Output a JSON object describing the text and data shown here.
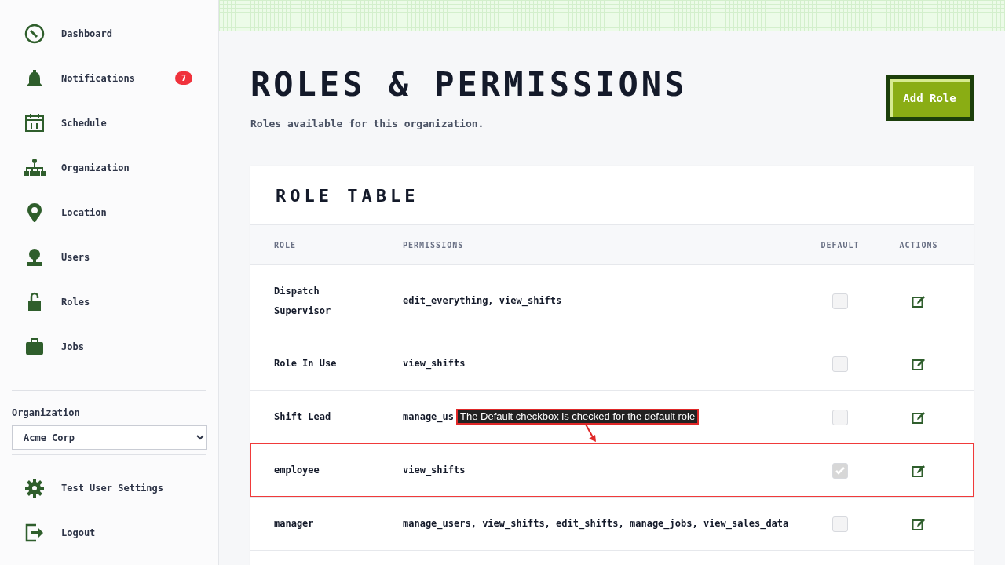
{
  "sidebar": {
    "items": [
      {
        "label": "Dashboard",
        "selected": false
      },
      {
        "label": "Notifications",
        "selected": false,
        "badge": "7"
      },
      {
        "label": "Schedule",
        "selected": false
      },
      {
        "label": "Organization",
        "selected": false
      },
      {
        "label": "Location",
        "selected": false
      },
      {
        "label": "Users",
        "selected": false
      },
      {
        "label": "Roles",
        "selected": false
      },
      {
        "label": "Jobs",
        "selected": false
      }
    ],
    "organization_label": "Organization",
    "organization_value": "Acme Corp",
    "footer_items": [
      {
        "label": "Test User Settings"
      },
      {
        "label": "Logout"
      }
    ]
  },
  "page": {
    "title": "ROLES & PERMISSIONS",
    "subtitle": "Roles available for this organization.",
    "add_button": "Add Role"
  },
  "table": {
    "title": "ROLE TABLE",
    "columns": [
      "ROLE",
      "PERMISSIONS",
      "DEFAULT",
      "ACTIONS"
    ],
    "rows": [
      {
        "role": "Dispatch Supervisor",
        "permissions": "edit_everything, view_shifts",
        "default": false,
        "highlighted": false
      },
      {
        "role": "Role In Use",
        "permissions": "view_shifts",
        "default": false,
        "highlighted": false
      },
      {
        "role": "Shift Lead",
        "permissions": "manage_us",
        "default": false,
        "highlighted": false
      },
      {
        "role": "employee",
        "permissions": "view_shifts",
        "default": true,
        "highlighted": true
      },
      {
        "role": "manager",
        "permissions": "manage_users, view_shifts, edit_shifts, manage_jobs, view_sales_data",
        "default": false,
        "highlighted": false
      }
    ]
  },
  "annotation": {
    "text": "The Default checkbox is checked for the default role"
  }
}
